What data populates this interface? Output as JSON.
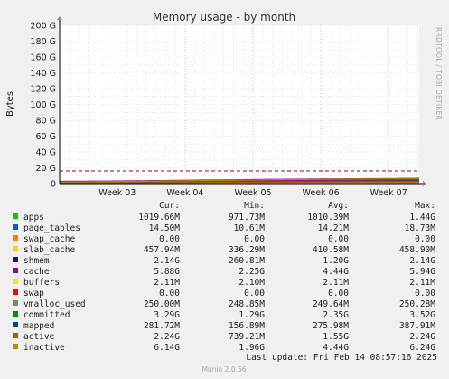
{
  "colors": {
    "background": "#f0f0f0",
    "plot_background": "#ffffff",
    "grid_major": "#e8a0a0",
    "grid_minor": "#e8c8c8",
    "max_line": "#990000"
  },
  "side_label": "RRDTOOL / TOBI OETIKER",
  "footer": {
    "last_update": "Last update: Fri Feb 14 08:57:16 2025",
    "version": "Munin 2.0.56"
  },
  "legend": {
    "headers": [
      "Cur:",
      "Min:",
      "Avg:",
      "Max:"
    ],
    "rows": [
      {
        "name": "apps",
        "color": "#00cc00",
        "cur": "1019.66M",
        "min": "971.73M",
        "avg": "1010.39M",
        "max": "1.44G"
      },
      {
        "name": "page_tables",
        "color": "#0066b3",
        "cur": "14.50M",
        "min": "10.61M",
        "avg": "14.21M",
        "max": "18.73M"
      },
      {
        "name": "swap_cache",
        "color": "#ff8000",
        "cur": "0.00",
        "min": "0.00",
        "avg": "0.00",
        "max": "0.00"
      },
      {
        "name": "slab_cache",
        "color": "#ffcc00",
        "cur": "457.94M",
        "min": "336.29M",
        "avg": "410.58M",
        "max": "458.90M"
      },
      {
        "name": "shmem",
        "color": "#330099",
        "cur": "2.14G",
        "min": "260.81M",
        "avg": "1.20G",
        "max": "2.14G"
      },
      {
        "name": "cache",
        "color": "#990099",
        "cur": "5.88G",
        "min": "2.25G",
        "avg": "4.44G",
        "max": "5.94G"
      },
      {
        "name": "buffers",
        "color": "#ccff00",
        "cur": "2.11M",
        "min": "2.10M",
        "avg": "2.11M",
        "max": "2.11M"
      },
      {
        "name": "swap",
        "color": "#ff0000",
        "cur": "0.00",
        "min": "0.00",
        "avg": "0.00",
        "max": "0.00"
      },
      {
        "name": "vmalloc_used",
        "color": "#808080",
        "cur": "250.00M",
        "min": "248.85M",
        "avg": "249.64M",
        "max": "250.28M"
      },
      {
        "name": "committed",
        "color": "#008f00",
        "cur": "3.29G",
        "min": "1.29G",
        "avg": "2.35G",
        "max": "3.52G"
      },
      {
        "name": "mapped",
        "color": "#00487d",
        "cur": "281.72M",
        "min": "156.89M",
        "avg": "275.98M",
        "max": "387.91M"
      },
      {
        "name": "active",
        "color": "#b35a00",
        "cur": "2.24G",
        "min": "739.21M",
        "avg": "1.55G",
        "max": "2.24G"
      },
      {
        "name": "inactive",
        "color": "#b38f00",
        "cur": "6.14G",
        "min": "1.96G",
        "avg": "4.44G",
        "max": "6.24G"
      }
    ]
  },
  "chart_data": {
    "type": "area",
    "title": "Memory usage - by month",
    "ylabel": "Bytes",
    "xlabel": "",
    "ylim": [
      0,
      200
    ],
    "y_unit": "G",
    "y_ticks": [
      "0",
      "20 G",
      "40 G",
      "60 G",
      "80 G",
      "100 G",
      "120 G",
      "140 G",
      "160 G",
      "180 G",
      "200 G"
    ],
    "x_ticks": [
      "Week 03",
      "Week 04",
      "Week 05",
      "Week 06",
      "Week 07"
    ],
    "x_range_weeks": [
      2.15,
      7.45
    ],
    "grid": true,
    "max_dashed_line": 16,
    "series": [
      {
        "name": "apps",
        "values_g": [
          [
            2.15,
            1.0
          ],
          [
            7.45,
            1.0
          ]
        ]
      },
      {
        "name": "slab_cache",
        "values_g": [
          [
            2.15,
            0.34
          ],
          [
            7.45,
            0.46
          ]
        ]
      },
      {
        "name": "cache",
        "values_g": [
          [
            2.15,
            2.3
          ],
          [
            3.0,
            2.6
          ],
          [
            4.0,
            3.6
          ],
          [
            5.0,
            4.5
          ],
          [
            6.0,
            5.2
          ],
          [
            7.0,
            5.7
          ],
          [
            7.45,
            5.9
          ]
        ]
      },
      {
        "name": "committed",
        "values_g": [
          [
            2.15,
            1.3
          ],
          [
            3.0,
            1.6
          ],
          [
            4.0,
            2.1
          ],
          [
            5.0,
            2.5
          ],
          [
            6.0,
            3.0
          ],
          [
            7.0,
            3.3
          ],
          [
            7.45,
            3.3
          ]
        ]
      },
      {
        "name": "inactive",
        "values_g": [
          [
            2.15,
            2.0
          ],
          [
            3.0,
            2.6
          ],
          [
            4.0,
            3.6
          ],
          [
            5.0,
            4.6
          ],
          [
            6.0,
            5.5
          ],
          [
            7.0,
            6.1
          ],
          [
            7.45,
            6.1
          ]
        ]
      },
      {
        "name": "active",
        "values_g": [
          [
            2.15,
            0.75
          ],
          [
            3.0,
            1.0
          ],
          [
            4.0,
            1.4
          ],
          [
            5.0,
            1.7
          ],
          [
            6.0,
            2.0
          ],
          [
            7.0,
            2.2
          ],
          [
            7.45,
            2.24
          ]
        ]
      }
    ]
  }
}
